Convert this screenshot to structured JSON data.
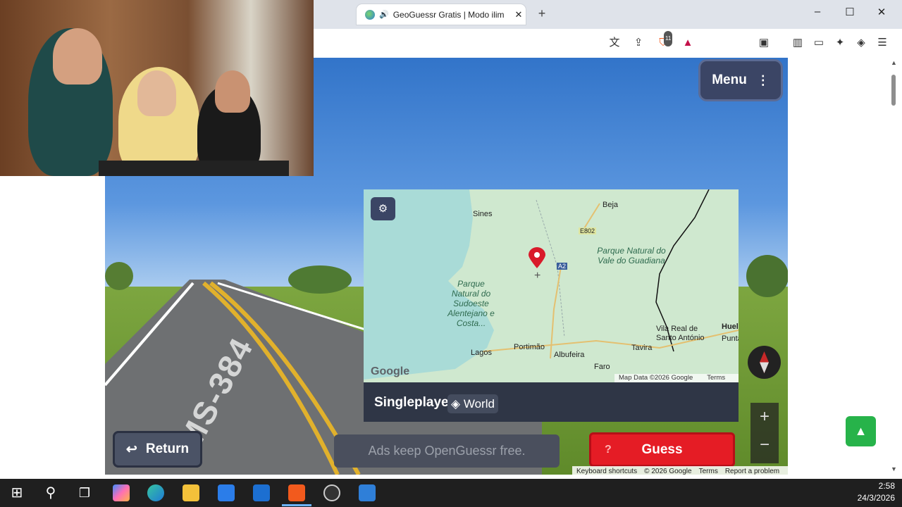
{
  "browser": {
    "tab_title": "GeoGuessr Gratis | Modo ilim",
    "new_tab_icon": "+",
    "window_controls": {
      "minimize": "–",
      "maximize": "☐",
      "close": "✕"
    },
    "toolbar_icons": [
      "translate-icon",
      "share-icon",
      "brave-shield-icon",
      "brave-rewards-icon",
      "reader-icon",
      "sidebar-icon",
      "wallet-icon",
      "leo-icon",
      "vpn-icon",
      "menu-icon"
    ],
    "shield_badge": "11"
  },
  "game": {
    "menu_label": "Menu",
    "return_label": "Return",
    "ads_text": "Ads keep OpenGuessr free.",
    "guess_label": "Guess",
    "guess_hint": "?",
    "mode_label": "Singleplayer",
    "map_mode_label": "World",
    "zoom_in": "+",
    "zoom_out": "−"
  },
  "map": {
    "labels": {
      "sines": "Sines",
      "beja": "Beja",
      "e802": "E802",
      "a2": "A2",
      "park_guadiana": "Parque Natural do Vale do Guadiana",
      "park_sudoeste": "Parque Natural do Sudoeste Alentejano e Costa...",
      "vila_real": "Vila Real de Santo António",
      "huelva": "Huel",
      "punta": "Punta",
      "lagos": "Lagos",
      "portimao": "Portimão",
      "albufeira": "Albufeira",
      "tavira": "Tavira",
      "faro": "Faro"
    },
    "google_logo": "Google",
    "map_data": "Map Data ©2026 Google",
    "terms": "Terms"
  },
  "streetview": {
    "road_marking": "MS-384",
    "footer": {
      "shortcuts": "Keyboard shortcuts",
      "copyright": "© 2026 Google",
      "terms": "Terms",
      "report": "Report a problem"
    }
  },
  "taskbar": {
    "time": "2:58",
    "date": "24/3/2026"
  },
  "colors": {
    "guess_red": "#e51c25",
    "menu_navy": "#3b4565",
    "up_green": "#27b34a"
  }
}
